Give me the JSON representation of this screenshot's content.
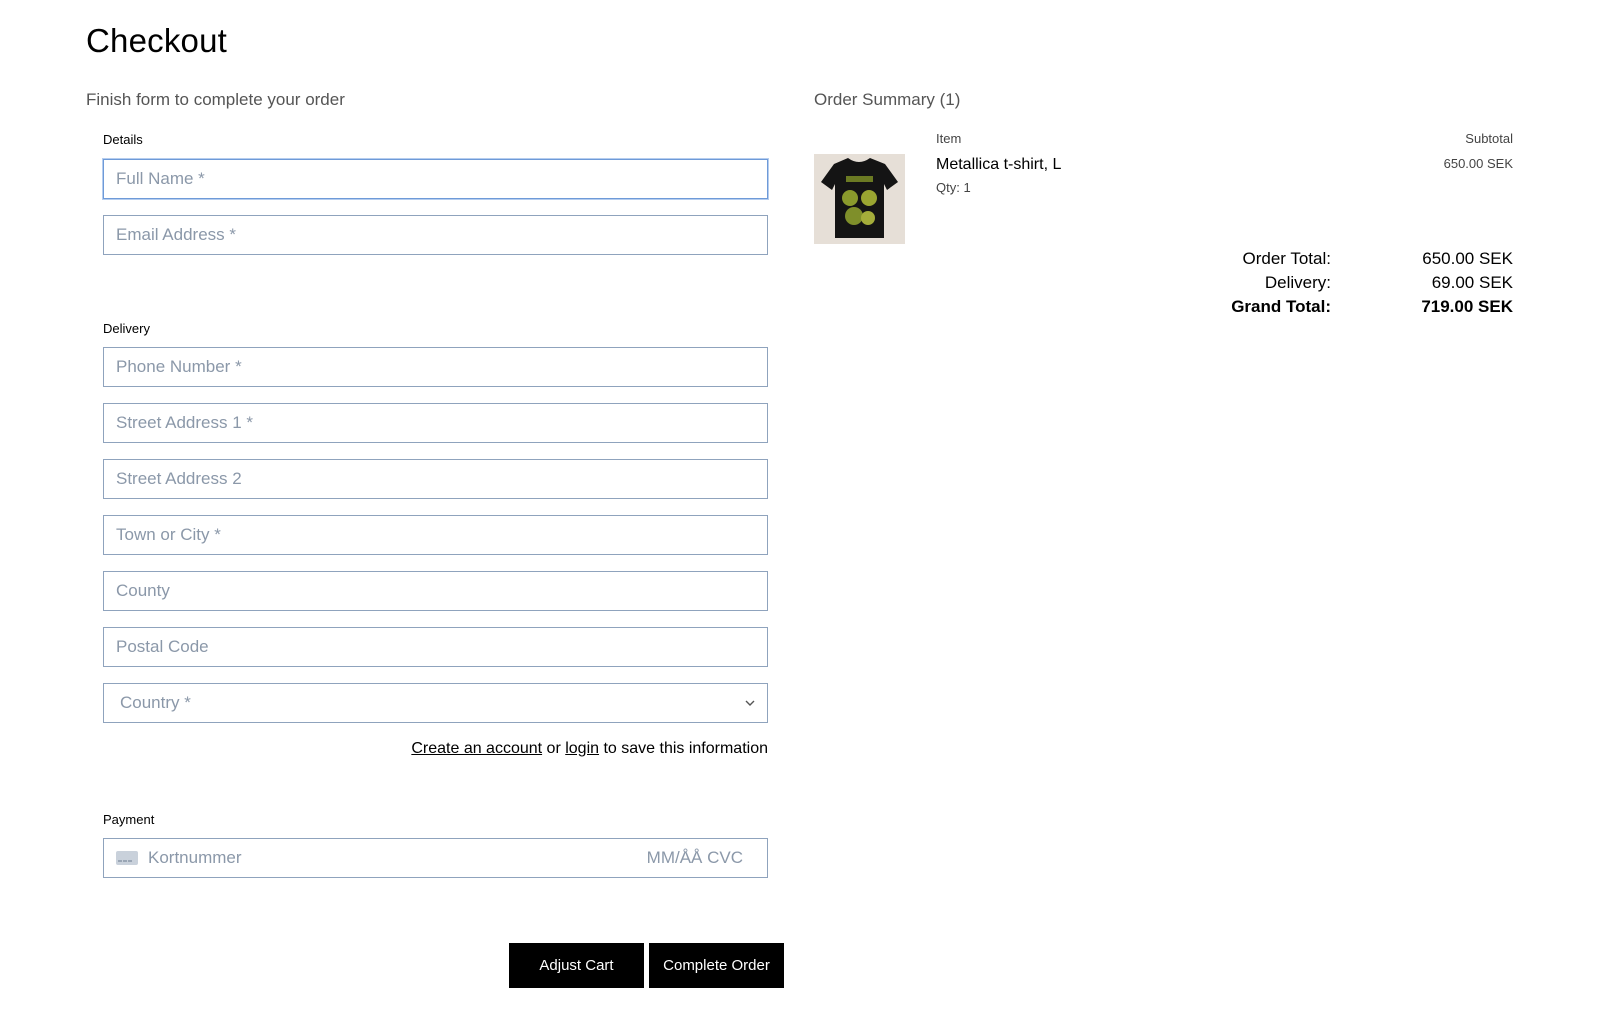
{
  "header": {
    "title": "Checkout",
    "subtitle": "Finish form to complete your order"
  },
  "details": {
    "label": "Details",
    "full_name_placeholder": "Full Name *",
    "email_placeholder": "Email Address *"
  },
  "delivery": {
    "label": "Delivery",
    "phone_placeholder": "Phone Number *",
    "street1_placeholder": "Street Address 1 *",
    "street2_placeholder": "Street Address 2",
    "town_placeholder": "Town or City *",
    "county_placeholder": "County",
    "postcode_placeholder": "Postal Code",
    "country_selected": "Country *"
  },
  "account": {
    "create_link": "Create an account",
    "or_text": " or ",
    "login_link": "login",
    "tail_text": " to save this information"
  },
  "payment": {
    "label": "Payment",
    "card_placeholder": "Kortnummer",
    "exp_cvc_placeholder": "MM/ÅÅ CVC"
  },
  "buttons": {
    "adjust_cart": "Adjust Cart",
    "complete_order": "Complete Order"
  },
  "summary": {
    "title": "Order Summary (1)",
    "col_item": "Item",
    "col_subtotal": "Subtotal",
    "items": [
      {
        "name": "Metallica t-shirt, L",
        "qty": "Qty: 1",
        "subtotal": "650.00 SEK"
      }
    ],
    "order_total_label": "Order Total:",
    "order_total_value": "650.00 SEK",
    "delivery_label": "Delivery:",
    "delivery_value": "69.00 SEK",
    "grand_total_label": "Grand Total:",
    "grand_total_value": "719.00 SEK"
  },
  "icons": {
    "card": "credit-card-icon",
    "select": "chevron-down-icon"
  },
  "colors": {
    "button_bg": "#000000",
    "field_border": "#8fa3bd",
    "focus_border": "#6e9ad8"
  }
}
